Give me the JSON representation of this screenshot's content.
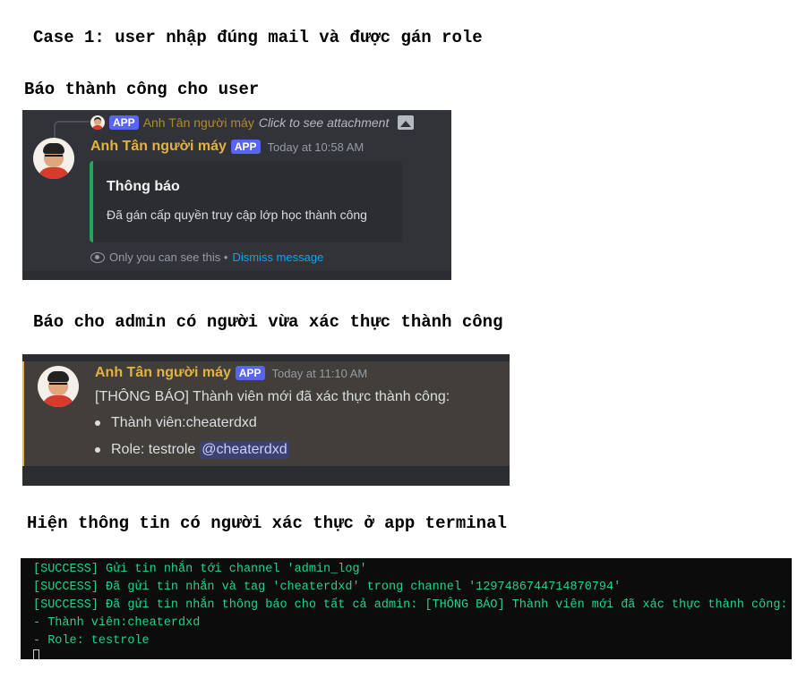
{
  "headings": {
    "case": "Case 1: user nhập đúng mail và được gán role",
    "user_notice": "Báo thành công cho user",
    "admin_notice": "Báo cho admin có người vừa xác thực thành công",
    "terminal_notice": "Hiện thông tin có người xác thực ở app terminal"
  },
  "panel1": {
    "reply": {
      "app_tag": "APP",
      "username": "Anh Tân người máy",
      "text": "Click to see attachment"
    },
    "username": "Anh Tân người máy",
    "app_tag": "APP",
    "timestamp": "Today at 10:58 AM",
    "embed": {
      "title": "Thông báo",
      "description": "Đã gán cấp quyền truy cập lớp học thành công",
      "accent_color": "#23a55a"
    },
    "ephemeral": {
      "note": "Only you can see this •",
      "dismiss": "Dismiss message"
    }
  },
  "panel2": {
    "username": "Anh Tân người máy",
    "app_tag": "APP",
    "timestamp": "Today at 11:10 AM",
    "line1": "[THÔNG BÁO] Thành viên mới đã xác thực thành công:",
    "bullet1": "Thành viên:cheaterdxd",
    "bullet2": "Role: testrole",
    "mention": "@cheaterdxd"
  },
  "terminal": {
    "lines": [
      "[SUCCESS] Gửi tin nhắn tới channel 'admin_log'",
      "[SUCCESS] Đã gửi tin nhắn và tag 'cheaterdxd' trong channel '1297486744714870794'",
      "[SUCCESS] Đã gửi tin nhắn thông báo cho tất cả admin: [THÔNG BÁO] Thành viên mới đã xác thực thành công:",
      "- Thành viên:cheaterdxd",
      "- Role: testrole"
    ],
    "text_color": "#23d18b"
  },
  "colors": {
    "discord_bg": "#313338",
    "app_tag": "#5865f2",
    "username": "#e3b341",
    "link": "#00a8fc"
  }
}
